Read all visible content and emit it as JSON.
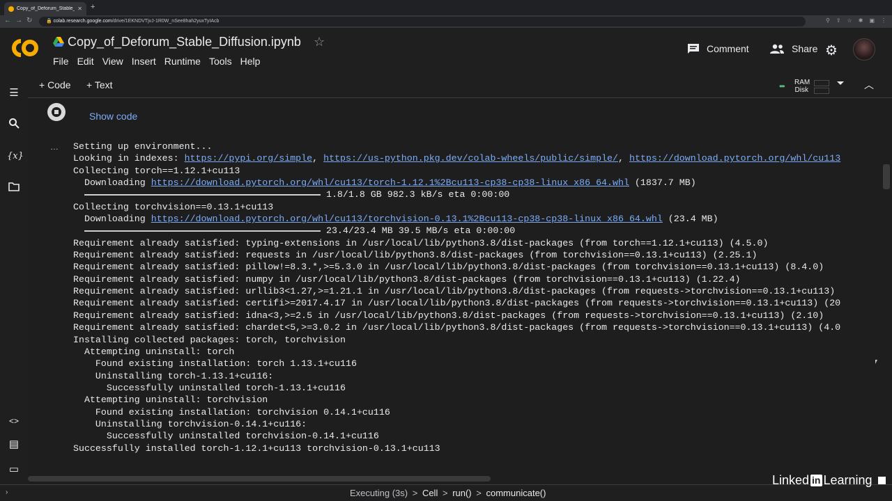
{
  "browser": {
    "tab_title": "Copy_of_Deforum_Stable_Di",
    "tab_close": "✕",
    "new_tab": "+",
    "url_host": "colab.research.google.com",
    "url_path": "/drive/1EKNDVTjvJ-1R0W_nSee8hah2yuxTyIAcb"
  },
  "header": {
    "logo_text": "CO",
    "notebook_title": "Copy_of_Deforum_Stable_Diffusion.ipynb",
    "menu": [
      "File",
      "Edit",
      "View",
      "Insert",
      "Runtime",
      "Tools",
      "Help"
    ],
    "comment_label": "Comment",
    "share_label": "Share"
  },
  "toolbar": {
    "add_code": "+ Code",
    "add_text": "+ Text",
    "ram_label": "RAM",
    "disk_label": "Disk"
  },
  "cell": {
    "show_code": "Show code",
    "output_menu": "…",
    "output": {
      "line1": "Setting up environment...",
      "line2_prefix": "Looking in indexes: ",
      "index1": "https://pypi.org/simple",
      "sep": ", ",
      "index2": "https://us-python.pkg.dev/colab-wheels/public/simple/",
      "index3": "https://download.pytorch.org/whl/cu113",
      "line3": "Collecting torch==1.12.1+cu113",
      "dl1_prefix": "  Downloading ",
      "dl1_link": "https://download.pytorch.org/whl/cu113/torch-1.12.1%2Bcu113-cp38-cp38-linux_x86_64.whl",
      "dl1_size": " (1837.7 MB)",
      "progress1": "1.8/1.8 GB 982.3 kB/s eta 0:00:00",
      "line6": "Collecting torchvision==0.13.1+cu113",
      "dl2_prefix": "  Downloading ",
      "dl2_link": "https://download.pytorch.org/whl/cu113/torchvision-0.13.1%2Bcu113-cp38-cp38-linux_x86_64.whl",
      "dl2_size": " (23.4 MB)",
      "progress2": "23.4/23.4 MB 39.5 MB/s eta 0:00:00",
      "req1": "Requirement already satisfied: typing-extensions in /usr/local/lib/python3.8/dist-packages (from torch==1.12.1+cu113) (4.5.0)",
      "req2": "Requirement already satisfied: requests in /usr/local/lib/python3.8/dist-packages (from torchvision==0.13.1+cu113) (2.25.1)",
      "req3": "Requirement already satisfied: pillow!=8.3.*,>=5.3.0 in /usr/local/lib/python3.8/dist-packages (from torchvision==0.13.1+cu113) (8.4.0)",
      "req4": "Requirement already satisfied: numpy in /usr/local/lib/python3.8/dist-packages (from torchvision==0.13.1+cu113) (1.22.4)",
      "req5": "Requirement already satisfied: urllib3<1.27,>=1.21.1 in /usr/local/lib/python3.8/dist-packages (from requests->torchvision==0.13.1+cu113)",
      "req6": "Requirement already satisfied: certifi>=2017.4.17 in /usr/local/lib/python3.8/dist-packages (from requests->torchvision==0.13.1+cu113) (20",
      "req7": "Requirement already satisfied: idna<3,>=2.5 in /usr/local/lib/python3.8/dist-packages (from requests->torchvision==0.13.1+cu113) (2.10)",
      "req8": "Requirement already satisfied: chardet<5,>=3.0.2 in /usr/local/lib/python3.8/dist-packages (from requests->torchvision==0.13.1+cu113) (4.0",
      "inst1": "Installing collected packages: torch, torchvision",
      "inst2": "  Attempting uninstall: torch",
      "inst3": "    Found existing installation: torch 1.13.1+cu116",
      "inst4": "    Uninstalling torch-1.13.1+cu116:",
      "inst5": "      Successfully uninstalled torch-1.13.1+cu116",
      "inst6": "  Attempting uninstall: torchvision",
      "inst7": "    Found existing installation: torchvision 0.14.1+cu116",
      "inst8": "    Uninstalling torchvision-0.14.1+cu116:",
      "inst9": "      Successfully uninstalled torchvision-0.14.1+cu116",
      "inst10": "Successfully installed torch-1.12.1+cu113 torchvision-0.13.1+cu113"
    }
  },
  "statusbar": {
    "executing": "Executing (3s)",
    "cell": "Cell",
    "run": "run()",
    "communicate": "communicate()",
    "sep": ">"
  },
  "watermark": {
    "linked": "Linked",
    "in": "in",
    "learning": " Learning"
  }
}
